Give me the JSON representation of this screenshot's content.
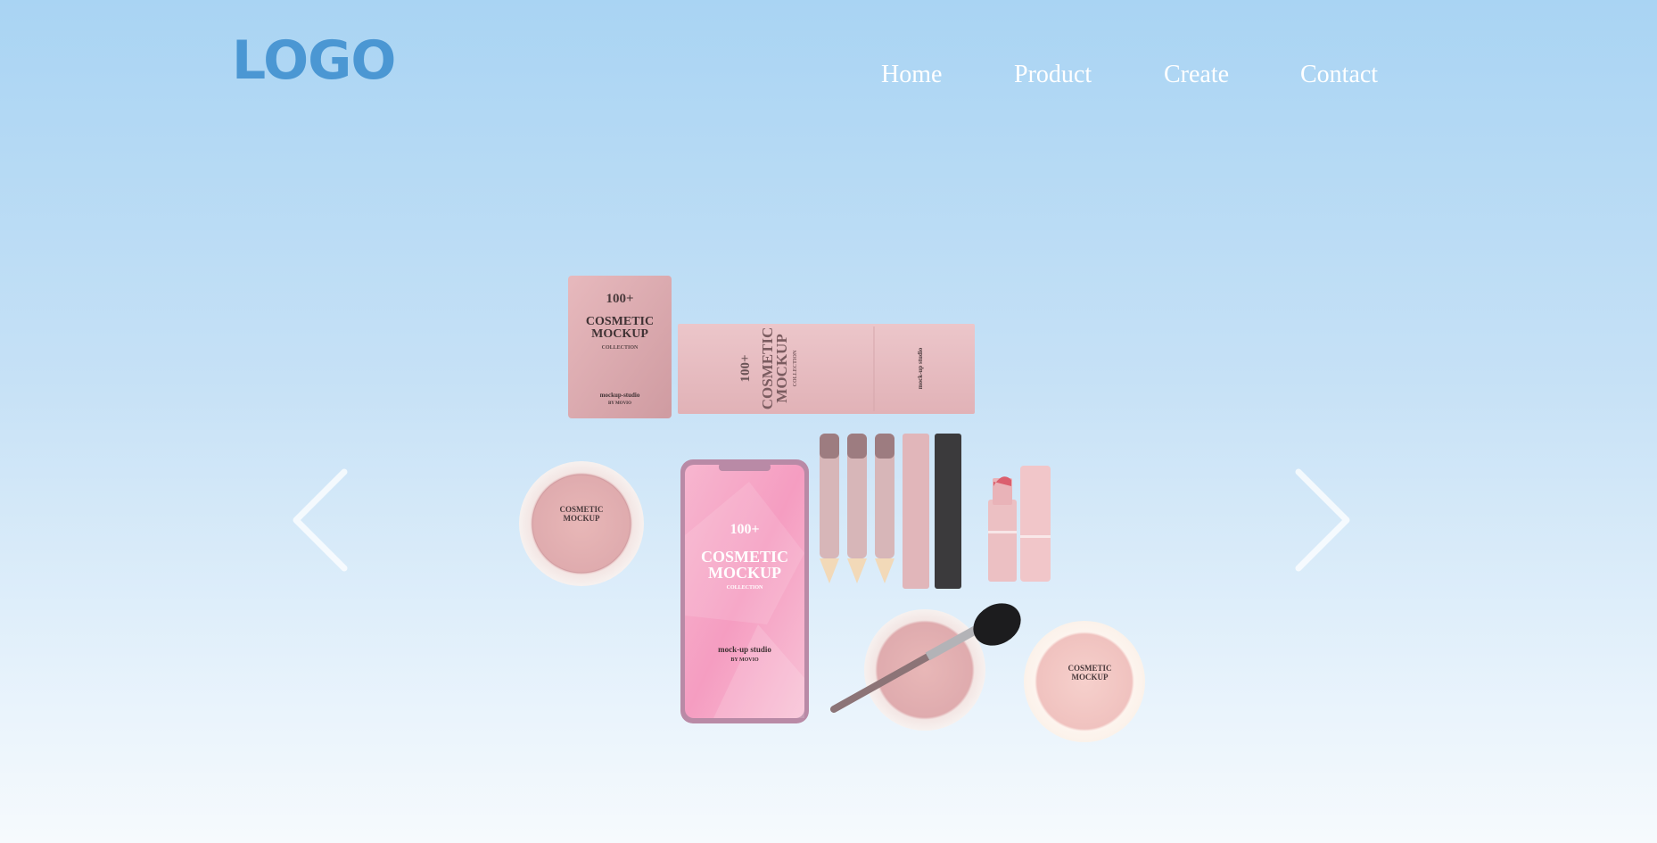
{
  "header": {
    "logo": "LOGO",
    "nav": [
      "Home",
      "Product",
      "Create",
      "Contact"
    ]
  },
  "carousel": {
    "prev_icon": "chevron-left-icon",
    "next_icon": "chevron-right-icon",
    "slide": {
      "sachet": {
        "count": "100+",
        "line1": "COSMETIC",
        "line2": "MOCKUP",
        "sub": "COLLECTION",
        "studio": "mockup-studio",
        "by": "BY MOVIO"
      },
      "box": {
        "count": "100+",
        "line1": "COSMETIC",
        "line2": "MOCKUP",
        "sub": "COLLECTION",
        "studio": "mock-up studio"
      },
      "phone": {
        "count": "100+",
        "line1": "COSMETIC",
        "line2": "MOCKUP",
        "sub": "COLLECTION",
        "studio": "mock-up studio",
        "by": "BY MOVIO"
      },
      "jar_left": {
        "line1": "COSMETIC",
        "line2": "MOCKUP"
      },
      "jar_right": {
        "line1": "COSMETIC",
        "line2": "MOCKUP"
      }
    }
  },
  "colors": {
    "logo": "#4b97d3",
    "nav_text": "#ffffff",
    "arrow": "#ffffff",
    "product_pink": "#e6bcc0",
    "phone_pink": "#f4a9c8"
  }
}
